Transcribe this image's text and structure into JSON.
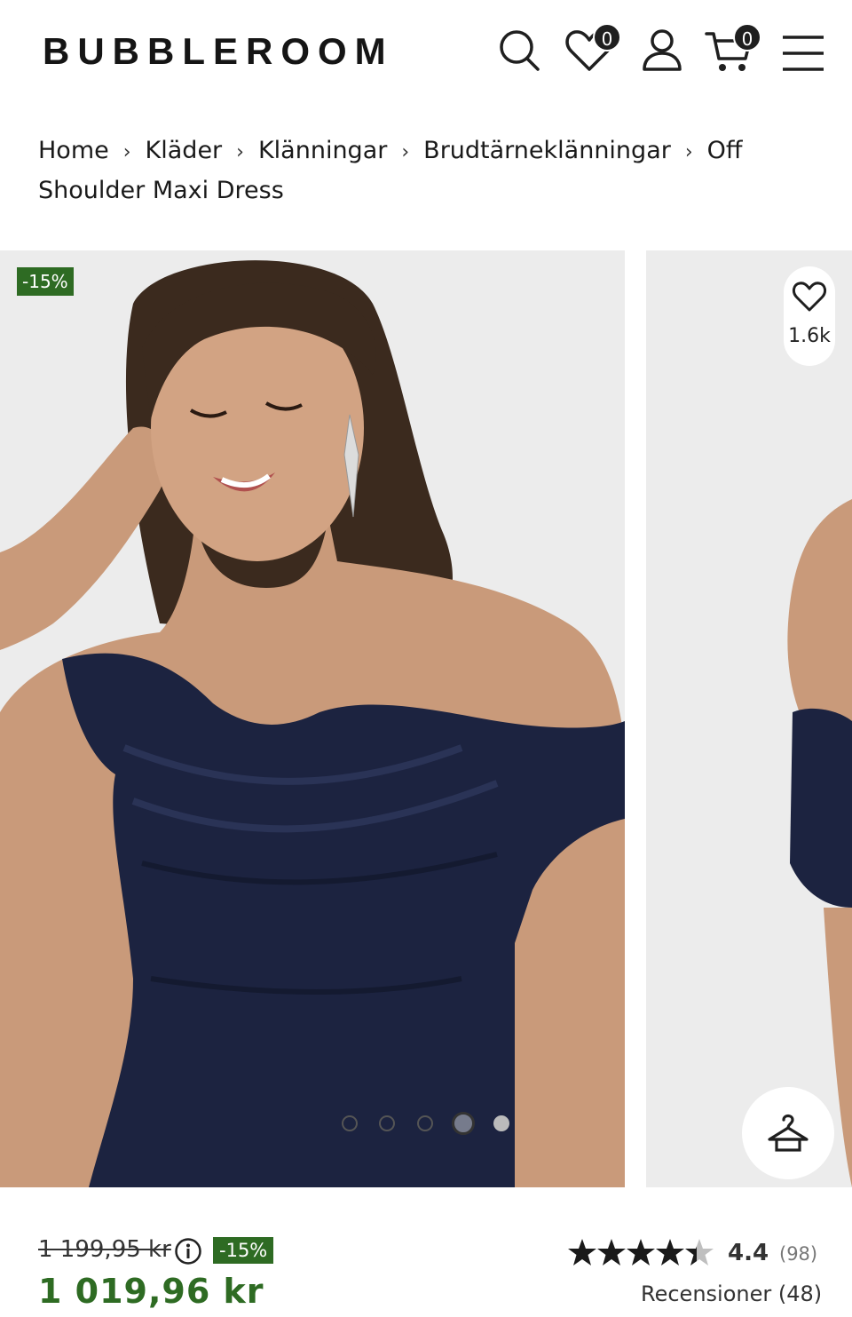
{
  "header": {
    "logo": "BUBBLEROOM",
    "wishlist_count": "0",
    "cart_count": "0",
    "icons": [
      "search-icon",
      "heart-icon",
      "user-icon",
      "cart-icon",
      "menu-icon"
    ]
  },
  "breadcrumb": {
    "items": [
      "Home",
      "Kläder",
      "Klänningar",
      "Brudtärneklänningar",
      "Off Shoulder Maxi Dress"
    ],
    "separator": "›"
  },
  "gallery": {
    "discount_badge": "-15%",
    "favorites_count": "1.6k",
    "slide_count": 5,
    "active_slide": 4
  },
  "price": {
    "original": "1 199,95 kr",
    "discount": "-15%",
    "current": "1 019,96 kr"
  },
  "rating": {
    "value": "4.4",
    "stars": 4.4,
    "count": "(98)",
    "reviews_label": "Recensioner (48)"
  },
  "colors": {
    "sale_green": "#2e6b23",
    "text_dark": "#1f1f1f",
    "photo_bg": "#ececec",
    "dress_navy": "#1c2340"
  }
}
